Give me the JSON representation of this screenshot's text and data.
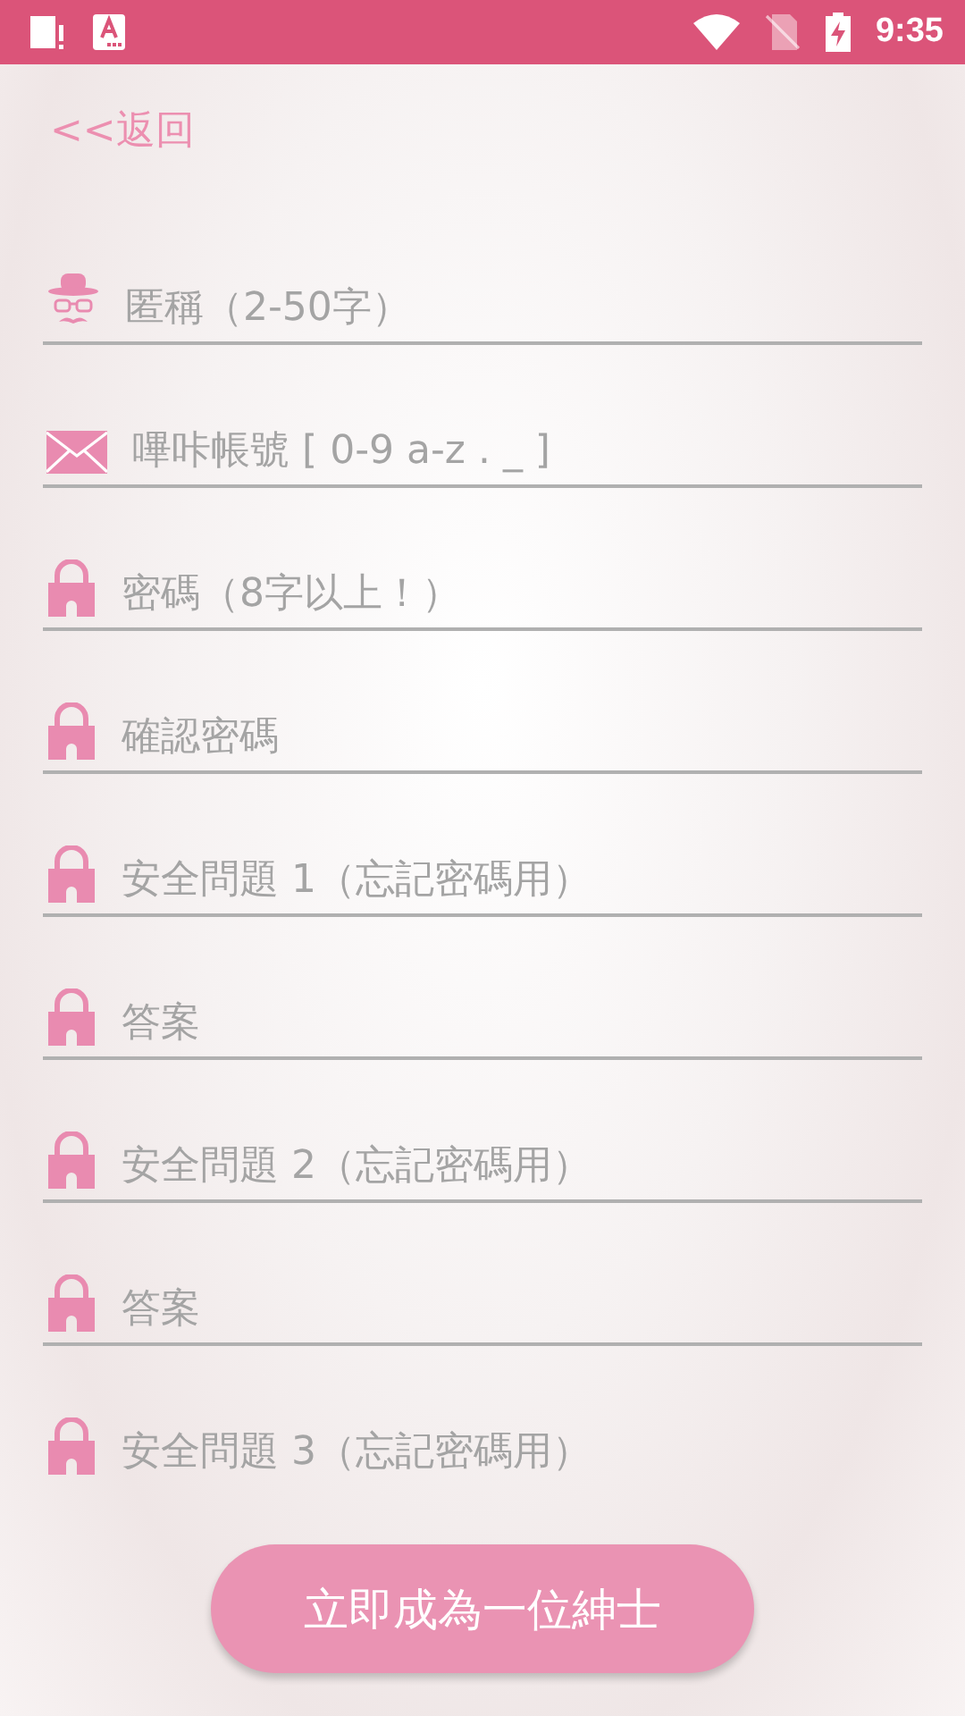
{
  "status_bar": {
    "time": "9:35"
  },
  "back_link": "<<返回",
  "fields": [
    {
      "kind": "hat",
      "placeholder": "匿稱（2-50字）"
    },
    {
      "kind": "envelope",
      "placeholder": "嗶咔帳號 [ 0-9 a-z . _ ]"
    },
    {
      "kind": "lock",
      "placeholder": "密碼（8字以上！）"
    },
    {
      "kind": "lock",
      "placeholder": "確認密碼"
    },
    {
      "kind": "lock",
      "placeholder": "安全問題 1（忘記密碼用）"
    },
    {
      "kind": "lock",
      "placeholder": "答案"
    },
    {
      "kind": "lock",
      "placeholder": "安全問題 2（忘記密碼用）"
    },
    {
      "kind": "lock",
      "placeholder": "答案"
    },
    {
      "kind": "lock",
      "placeholder": "安全問題 3（忘記密碼用）"
    }
  ],
  "submit_button": "立即成為一位紳士"
}
